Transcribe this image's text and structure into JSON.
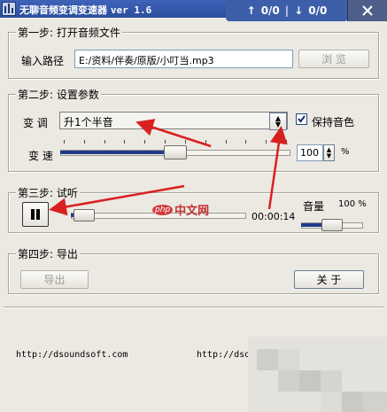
{
  "window": {
    "title": "无聊音频变调变速器",
    "version": "ver 1.6"
  },
  "net_widget": {
    "up": "0/0",
    "down": "0/0"
  },
  "step1": {
    "legend": "第一步: 打开音频文件",
    "path_label": "输入路径",
    "path_value": "E:/资料/伴奏/原版/小叮当.mp3",
    "browse_label": "浏  览"
  },
  "step2": {
    "legend": "第二步: 设置参数",
    "pitch_label": "变 调",
    "pitch_selected": "升1个半音",
    "keep_tone_label": "保持音色",
    "speed_label": "变 速",
    "speed_value": "100",
    "speed_unit": "%",
    "speed_level": 0.5
  },
  "step3": {
    "legend": "第三步: 试听",
    "time": "00:00:14",
    "volume_label": "音量",
    "volume_value": "100 %",
    "progress_level": 0.02,
    "volume_level": 0.5
  },
  "step4": {
    "legend": "第四步: 导出",
    "export_label": "导出",
    "about_label": "关  于"
  },
  "footer": {
    "url_left": "http://dsoundsoft.com",
    "url_right": "http://dsou"
  },
  "watermark": {
    "text": "中文网",
    "logo": "php"
  },
  "colors": {
    "titlebar": "#2a4f9e",
    "arrow": "#d92020",
    "slider_fill": "#1f3a8a"
  }
}
